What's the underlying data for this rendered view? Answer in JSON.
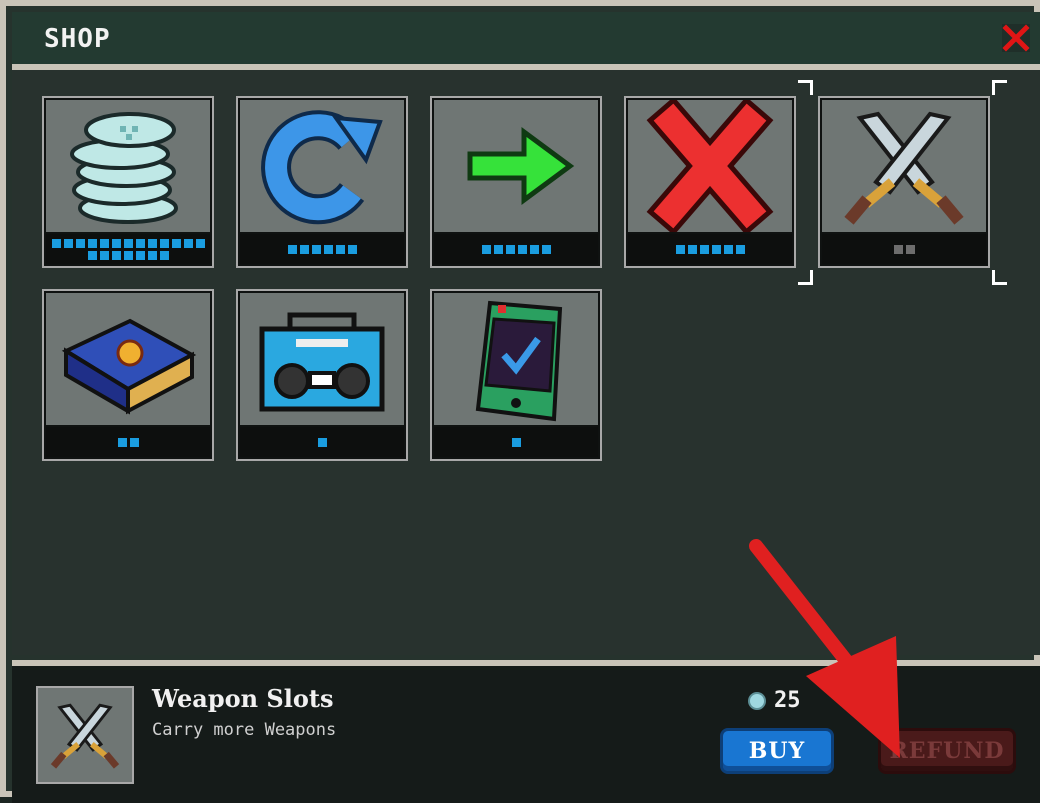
{
  "window": {
    "title": "SHOP"
  },
  "items": [
    {
      "id": "coins",
      "icon": "coin-stack-icon",
      "level": 20,
      "max": 20,
      "color": "#1a9de0"
    },
    {
      "id": "reroll",
      "icon": "reroll-icon",
      "level": 6,
      "max": 6,
      "color": "#1a9de0"
    },
    {
      "id": "skip",
      "icon": "green-arrow-icon",
      "level": 6,
      "max": 6,
      "color": "#1a9de0"
    },
    {
      "id": "banish",
      "icon": "red-x-icon",
      "level": 6,
      "max": 6,
      "color": "#1a9de0"
    },
    {
      "id": "weapon-slots",
      "icon": "crossed-swords-icon",
      "level": 0,
      "max": 2,
      "color": "#6d6d6d"
    },
    {
      "id": "tome",
      "icon": "spellbook-icon",
      "level": 2,
      "max": 2,
      "color": "#1a9de0"
    },
    {
      "id": "boombox",
      "icon": "boombox-icon",
      "level": 1,
      "max": 1,
      "color": "#1a9de0"
    },
    {
      "id": "phone",
      "icon": "phone-check-icon",
      "level": 1,
      "max": 1,
      "color": "#1a9de0"
    }
  ],
  "selected": {
    "name": "Weapon Slots",
    "description": "Carry more Weapons",
    "icon": "crossed-swords-icon",
    "price": "25",
    "currency_icon": "silver-coin-icon"
  },
  "buttons": {
    "buy": "BUY",
    "refund": "REFUND"
  },
  "annotation": {
    "icon": "red-arrow-icon",
    "color": "#e02020"
  }
}
